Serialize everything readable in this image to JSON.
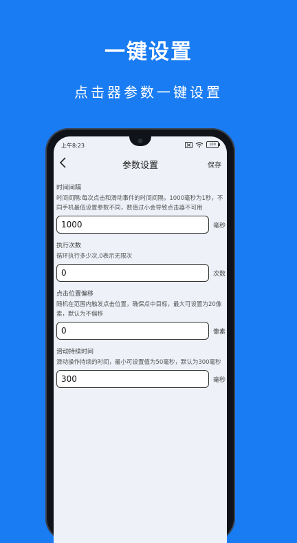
{
  "promo": {
    "title": "一键设置",
    "subtitle": "点击器参数一键设置"
  },
  "status_bar": {
    "time": "上午8:23",
    "battery": "100",
    "icons": [
      "sim-off-icon",
      "wifi-icon",
      "battery-icon"
    ]
  },
  "nav": {
    "title": "参数设置",
    "save_label": "保存",
    "back_icon": "chevron-left-icon"
  },
  "fields": [
    {
      "title": "时间间隔",
      "description": "时间间隔:每次点击和滑动事件的时间间隔，1000毫秒为1秒，不同手机最低设置参数不同，数值过小会导致点击器不可用",
      "value": "1000",
      "unit": "毫秒"
    },
    {
      "title": "执行次数",
      "description": "循环执行多少次,0表示无限次",
      "value": "0",
      "unit": "次数"
    },
    {
      "title": "点击位置偏移",
      "description": "随机在范围内触发点击位置，确保点中目标，最大可设置为20像素，默认为不偏移",
      "value": "0",
      "unit": "像素"
    },
    {
      "title": "滑动持续时间",
      "description": "滑动操作持续的时间，最小可设置值为50毫秒，默认为300毫秒",
      "value": "300",
      "unit": "毫秒"
    }
  ],
  "colors": {
    "background": "#1a7cf2",
    "screen": "#eef1f8",
    "phone_frame": "#101318"
  }
}
